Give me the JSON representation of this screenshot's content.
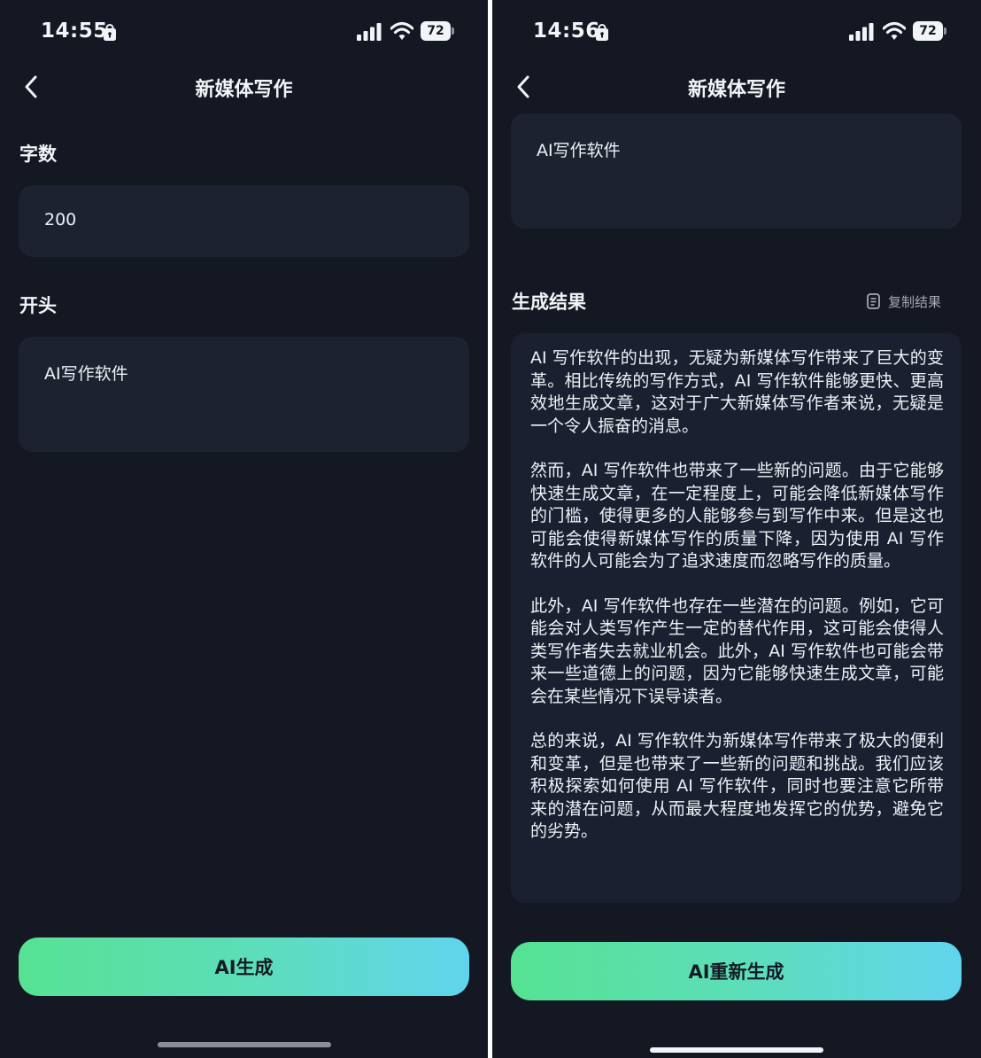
{
  "left": {
    "status": {
      "time": "14:55",
      "battery": "72"
    },
    "nav": {
      "title": "新媒体写作"
    },
    "word_count": {
      "label": "字数",
      "value": "200"
    },
    "opening": {
      "label": "开头",
      "value": "AI写作软件"
    },
    "generate_button": "AI生成"
  },
  "right": {
    "status": {
      "time": "14:56",
      "battery": "72"
    },
    "nav": {
      "title": "新媒体写作"
    },
    "opening": {
      "value": "AI写作软件"
    },
    "result": {
      "label": "生成结果",
      "copy_label": "复制结果",
      "paragraphs": [
        "AI 写作软件的出现，无疑为新媒体写作带来了巨大的变革。相比传统的写作方式，AI 写作软件能够更快、更高效地生成文章，这对于广大新媒体写作者来说，无疑是一个令人振奋的消息。",
        "然而，AI 写作软件也带来了一些新的问题。由于它能够快速生成文章，在一定程度上，可能会降低新媒体写作的门槛，使得更多的人能够参与到写作中来。但是这也可能会使得新媒体写作的质量下降，因为使用 AI 写作软件的人可能会为了追求速度而忽略写作的质量。",
        "此外，AI 写作软件也存在一些潜在的问题。例如，它可能会对人类写作产生一定的替代作用，这可能会使得人类写作者失去就业机会。此外，AI 写作软件也可能会带来一些道德上的问题，因为它能够快速生成文章，可能会在某些情况下误导读者。",
        "总的来说，AI 写作软件为新媒体写作带来了极大的便利和变革，但是也带来了一些新的问题和挑战。我们应该积极探索如何使用 AI 写作软件，同时也要注意它所带来的潜在问题，从而最大程度地发挥它的优势，避免它的劣势。"
      ]
    },
    "regenerate_button": "AI重新生成"
  },
  "colors": {
    "background": "#141823",
    "card": "#1d2230",
    "button_gradient_start": "#56e293",
    "button_gradient_end": "#61d4ee"
  },
  "icons": [
    "chevron-left-icon",
    "lock-icon",
    "signal-icon",
    "wifi-icon",
    "battery-icon",
    "copy-icon"
  ]
}
